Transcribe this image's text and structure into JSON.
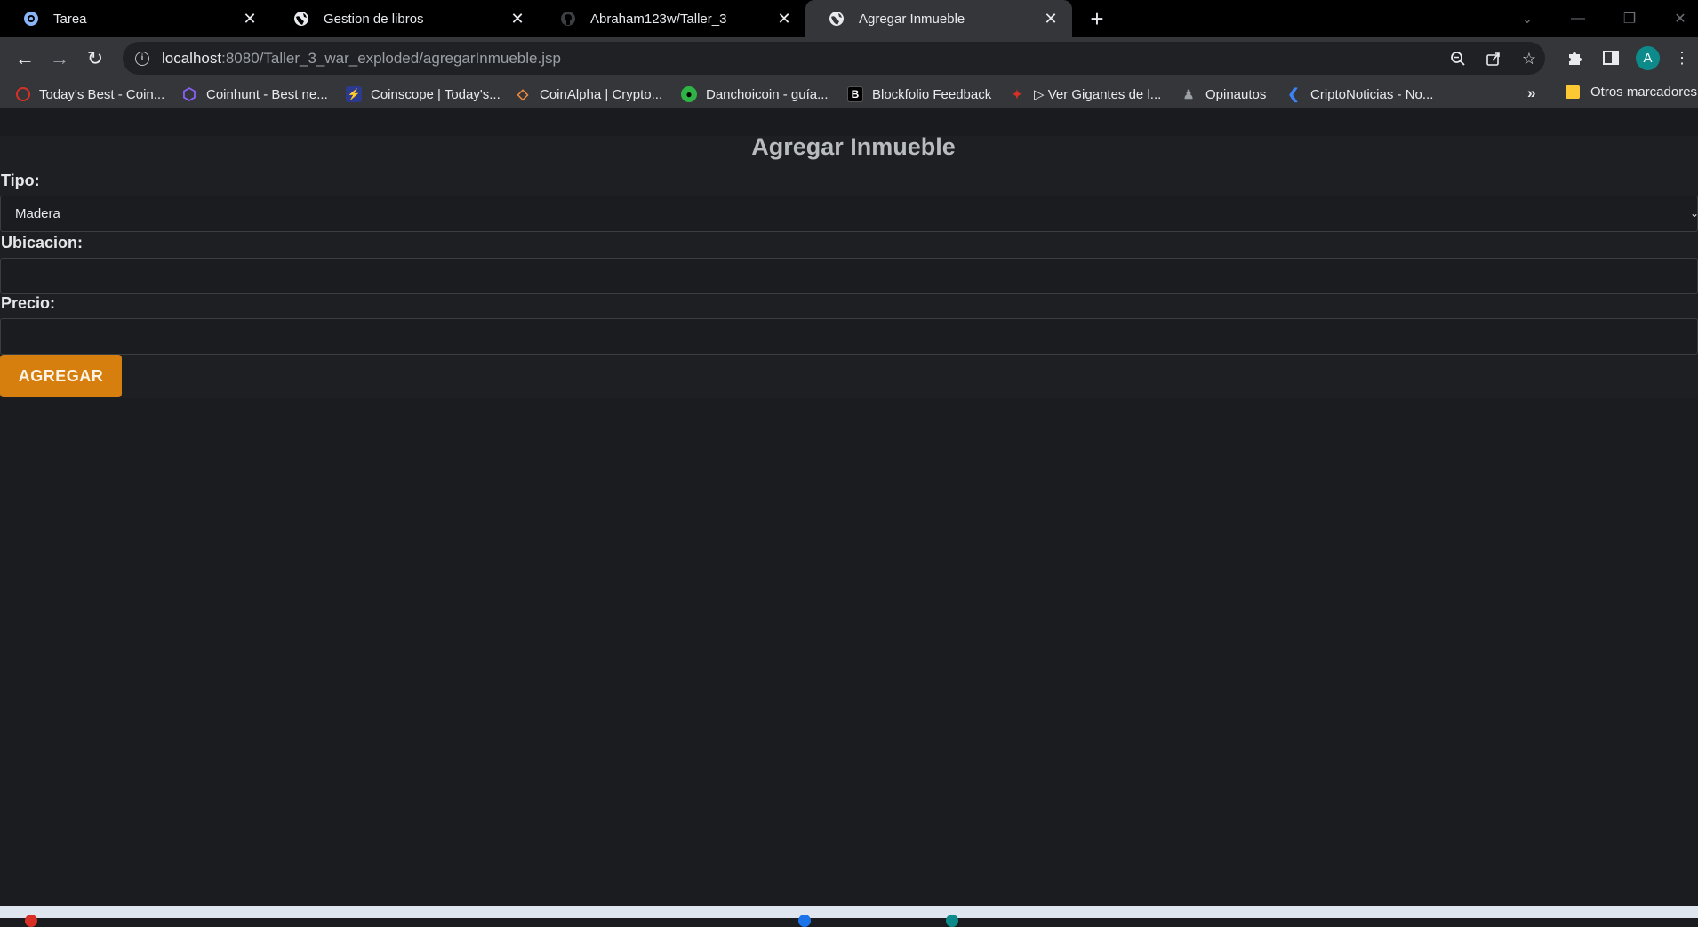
{
  "tabs": [
    {
      "title": "Tarea",
      "icon": "settings-globe-icon",
      "active": false
    },
    {
      "title": "Gestion de libros",
      "icon": "globe-icon",
      "active": false
    },
    {
      "title": "Abraham123w/Taller_3",
      "icon": "github-icon",
      "active": false
    },
    {
      "title": "Agregar Inmueble",
      "icon": "globe-icon",
      "active": true
    }
  ],
  "address_bar": {
    "host": "localhost",
    "path": ":8080/Taller_3_war_exploded/agregarInmueble.jsp"
  },
  "profile": {
    "initial": "A",
    "color": "#0d8b8b"
  },
  "bookmarks": [
    {
      "label": "Today's Best - Coin...",
      "icon_color": "#d93025",
      "icon": "coin-icon"
    },
    {
      "label": "Coinhunt - Best ne...",
      "icon_color": "#8a63ff",
      "icon": "hexagon-icon"
    },
    {
      "label": "Coinscope | Today's...",
      "icon_color": "#3b6cf0",
      "icon": "scope-icon"
    },
    {
      "label": "CoinAlpha | Crypto...",
      "icon_color": "#f08a3b",
      "icon": "alpha-icon"
    },
    {
      "label": "Danchoicoin - guía...",
      "icon_color": "#2fb344",
      "icon": "coin-icon"
    },
    {
      "label": "Blockfolio Feedback",
      "icon_color": "#ffffff",
      "icon": "b-icon",
      "icon_text": "B"
    },
    {
      "label": "▷ Ver Gigantes de l...",
      "icon_color": "#e8eaed",
      "icon": "play-icon"
    },
    {
      "label": "Opinautos",
      "icon_color": "#9aa0a6",
      "icon": "opinautos-icon"
    },
    {
      "label": "CriptoNoticias - No...",
      "icon_color": "#3b82f6",
      "icon": "cripto-icon"
    }
  ],
  "bookmarks_overflow": "»",
  "other_bookmarks": "Otros marcadores",
  "form": {
    "title": "Agregar Inmueble",
    "tipo_label": "Tipo:",
    "tipo_value": "Madera",
    "ubicacion_label": "Ubicacion:",
    "ubicacion_value": "",
    "precio_label": "Precio:",
    "precio_value": "",
    "submit_label": "AGREGAR"
  },
  "colors": {
    "accent_button": "#d67f0f",
    "page_background": "#1b1c1f"
  }
}
